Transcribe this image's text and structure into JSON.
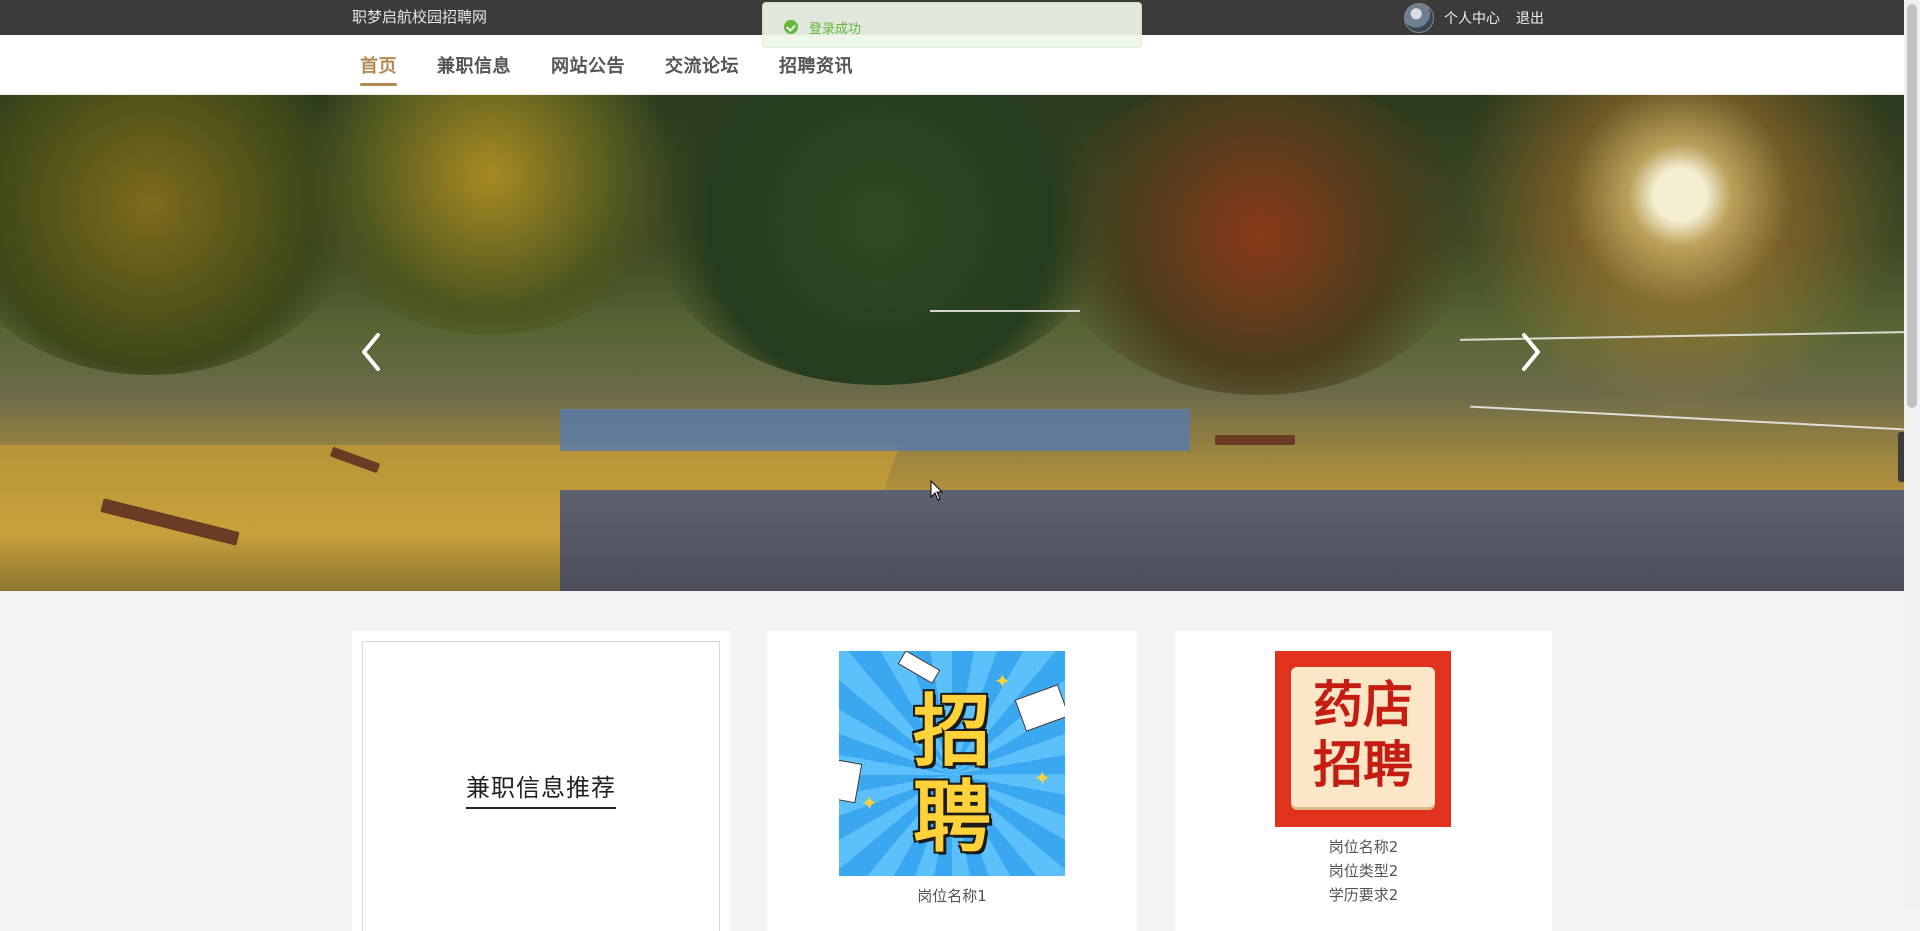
{
  "topbar": {
    "site_title": "职梦启航校园招聘网",
    "user_center": "个人中心",
    "logout": "退出"
  },
  "toast": {
    "message": "登录成功",
    "icon": "check-circle-icon",
    "color": "#67c23a"
  },
  "nav": {
    "items": [
      {
        "label": "首页",
        "active": true
      },
      {
        "label": "兼职信息",
        "active": false
      },
      {
        "label": "网站公告",
        "active": false
      },
      {
        "label": "交流论坛",
        "active": false
      },
      {
        "label": "招聘资讯",
        "active": false
      }
    ],
    "accent_color": "#b38a53"
  },
  "banner": {
    "prev_icon": "chevron-left-icon",
    "next_icon": "chevron-right-icon"
  },
  "recommend": {
    "title": "兼职信息推荐"
  },
  "jobs": [
    {
      "image_text": [
        "招",
        "聘"
      ],
      "lines": [
        "岗位名称1"
      ]
    },
    {
      "image_text": [
        "药店",
        "招聘"
      ],
      "lines": [
        "岗位名称2",
        "岗位类型2",
        "学历要求2"
      ]
    }
  ]
}
